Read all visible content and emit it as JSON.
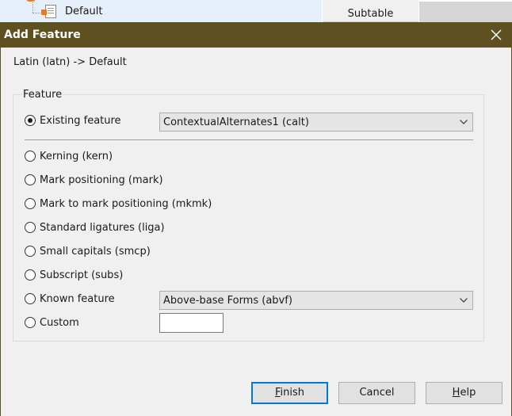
{
  "background": {
    "tree_item_label": "Default",
    "tab_label": "Subtable"
  },
  "dialog": {
    "title": "Add Feature",
    "path_label": "Latin (latn) -> Default",
    "group_title": "Feature",
    "existing": {
      "label": "Existing feature",
      "selected": "ContextualAlternates1 (calt)",
      "checked": true
    },
    "options": [
      {
        "label": "Kerning (kern)"
      },
      {
        "label": "Mark positioning (mark)"
      },
      {
        "label": "Mark to mark positioning (mkmk)"
      },
      {
        "label": "Standard ligatures (liga)"
      },
      {
        "label": "Small capitals (smcp)"
      },
      {
        "label": "Subscript (subs)"
      }
    ],
    "known": {
      "label": "Known feature",
      "selected": "Above-base Forms (abvf)"
    },
    "custom": {
      "label": "Custom",
      "value": ""
    },
    "buttons": {
      "finish_first": "F",
      "finish_rest": "inish",
      "cancel": "Cancel",
      "help_first": "H",
      "help_rest": "elp"
    }
  },
  "colors": {
    "title_bar": "#5e5020",
    "dialog_bg": "#f0f0f0",
    "default_button_border": "#0078d7"
  }
}
